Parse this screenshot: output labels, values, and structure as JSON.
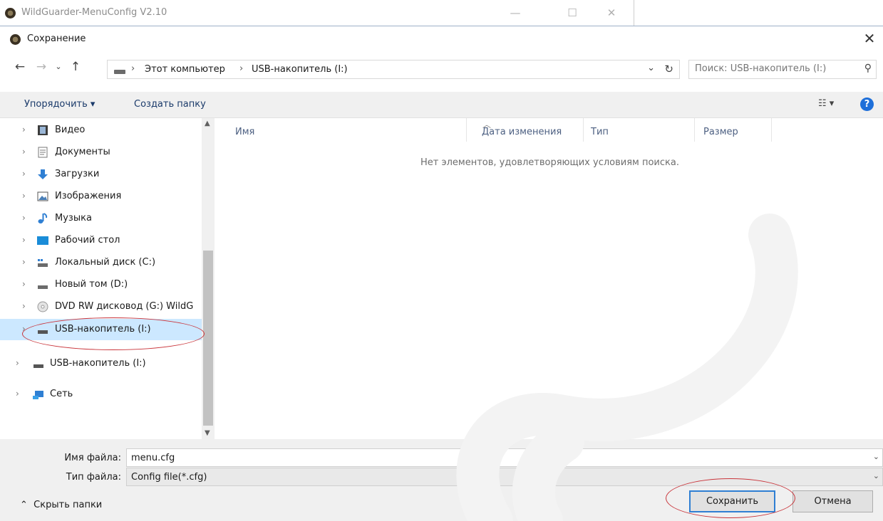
{
  "parent_window": {
    "title": "WildGuarder-MenuConfig V2.10",
    "minimize": "—",
    "maximize": "☐",
    "close": "✕"
  },
  "dialog": {
    "title": "Сохранение",
    "close": "✕"
  },
  "address": {
    "crumbs": [
      "Этот компьютер",
      "USB-накопитель (I:)"
    ],
    "search_placeholder": "Поиск: USB-накопитель (I:)"
  },
  "toolbar": {
    "organize": "Упорядочить ▾",
    "new_folder": "Создать папку",
    "view": "☷ ▾",
    "help": "?"
  },
  "nav": {
    "items": [
      {
        "label": "Видео",
        "icon": "video-icon"
      },
      {
        "label": "Документы",
        "icon": "documents-icon"
      },
      {
        "label": "Загрузки",
        "icon": "downloads-icon"
      },
      {
        "label": "Изображения",
        "icon": "pictures-icon"
      },
      {
        "label": "Музыка",
        "icon": "music-icon"
      },
      {
        "label": "Рабочий стол",
        "icon": "desktop-icon"
      },
      {
        "label": "Локальный диск (C:)",
        "icon": "local-disk-icon"
      },
      {
        "label": "Новый том (D:)",
        "icon": "drive-icon"
      },
      {
        "label": "DVD RW дисковод (G:) WildG",
        "icon": "dvd-icon"
      },
      {
        "label": "USB-накопитель (I:)",
        "icon": "usb-drive-icon",
        "selected": true
      },
      {
        "label": "USB-накопитель (I:)",
        "icon": "usb-drive-icon"
      },
      {
        "label": "Сеть",
        "icon": "network-icon"
      }
    ]
  },
  "filelist": {
    "columns": [
      "Имя",
      "Дата изменения",
      "Тип",
      "Размер"
    ],
    "empty_message": "Нет элементов, удовлетворяющих условиям поиска."
  },
  "form": {
    "filename_label": "Имя файла:",
    "filename_value": "menu.cfg",
    "filetype_label": "Тип файла:",
    "filetype_value": "Config file(*.cfg)"
  },
  "footer": {
    "hide_folders": "Скрыть папки",
    "save": "Сохранить",
    "cancel": "Отмена"
  },
  "colors": {
    "selection": "#cce8ff",
    "annotation": "#c9343a",
    "accent": "#2f7fd3"
  }
}
